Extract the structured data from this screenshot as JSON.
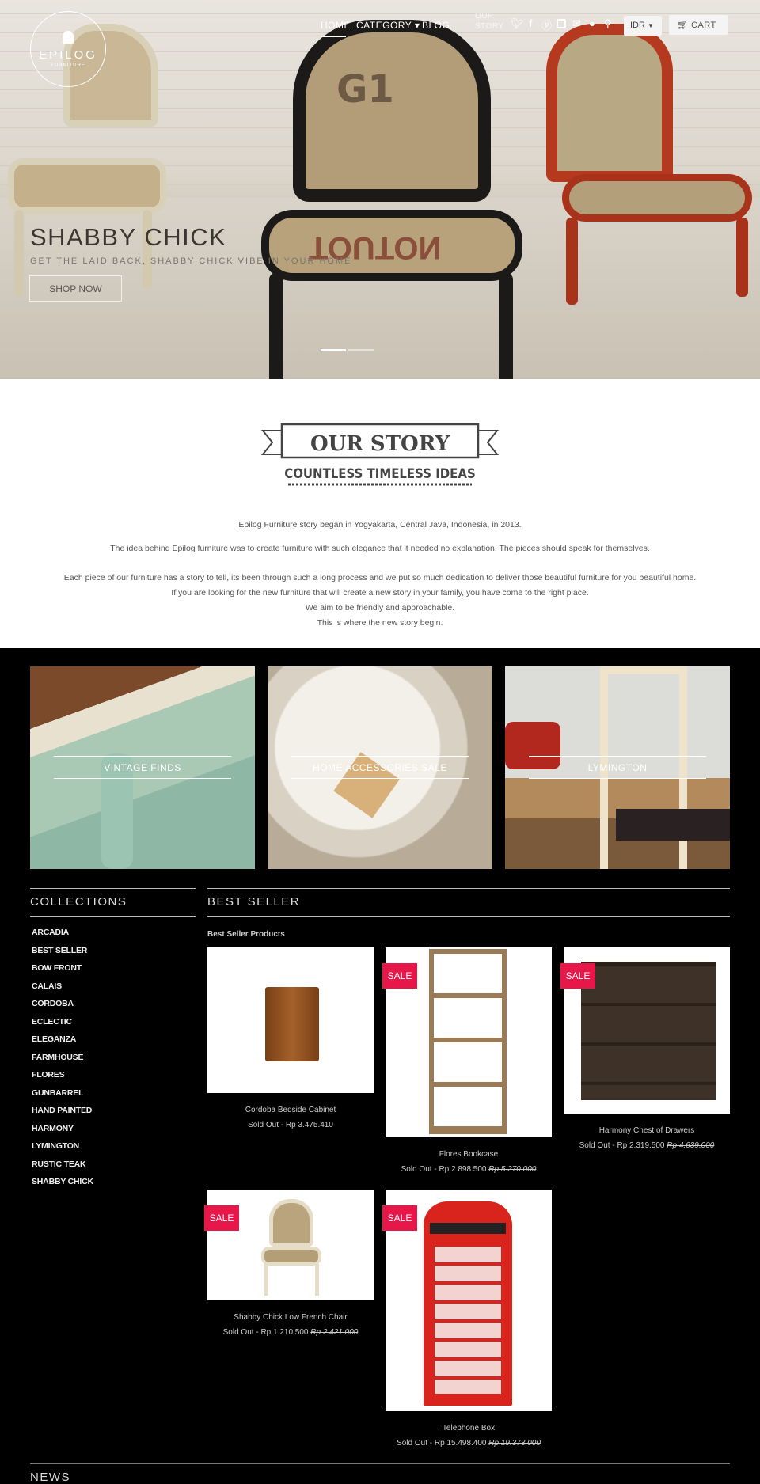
{
  "header": {
    "logo": {
      "name": "EPILOG",
      "sub": "FURNITURE"
    },
    "nav": [
      {
        "label": "HOME"
      },
      {
        "label": "CATEGORY ▾"
      },
      {
        "label": "BLOG"
      },
      {
        "label": "OUR STORY"
      }
    ],
    "icons": [
      "twitter-icon",
      "facebook-icon",
      "pinterest-icon",
      "instagram-icon",
      "mail-icon",
      "user-icon",
      "search-icon"
    ],
    "currency": "IDR",
    "cart_label": "CART"
  },
  "hero": {
    "title": "SHABBY CHICK",
    "subtitle": "GET THE LAID BACK, SHABBY CHICK VIBE IN YOUR HOME",
    "button": "SHOP NOW"
  },
  "story": {
    "banner_title": "OUR STORY",
    "banner_sub": "COUNTLESS TIMELESS IDEAS",
    "lines": [
      "Epilog Furniture story began in Yogyakarta, Central Java, Indonesia, in 2013.",
      "The idea behind Epilog furniture was to create furniture with such elegance that it needed no explanation. The pieces should speak for themselves.",
      "Each piece of our furniture has a story to tell, its been through such a long process and we put so much dedication to deliver those beautiful furniture for you beautiful home.",
      "If you are looking for the new furniture that will create a new story in your family, you have come to the right place.",
      "We aim to be friendly and approachable.",
      "This is where the new story begin."
    ]
  },
  "categories": [
    {
      "label": "VINTAGE FINDS"
    },
    {
      "label": "HOME ACCESSORIES SALE"
    },
    {
      "label": "LYMINGTON"
    }
  ],
  "collections": {
    "title": "COLLECTIONS",
    "items": [
      "ARCADIA",
      "BEST SELLER",
      "BOW FRONT",
      "CALAIS",
      "CORDOBA",
      "ECLECTIC",
      "ELEGANZA",
      "FARMHOUSE",
      "FLORES",
      "GUNBARREL",
      "HAND PAINTED",
      "HARMONY",
      "LYMINGTON",
      "RUSTIC TEAK",
      "SHABBY CHICK"
    ]
  },
  "bestseller": {
    "title": "BEST SELLER",
    "subtitle": "Best Seller Products",
    "sale_label": "SALE",
    "products": [
      {
        "name": "Cordoba Bedside Cabinet",
        "price": "Sold Out - Rp 3.475.410",
        "old_price": ""
      },
      {
        "name": "Flores Bookcase",
        "price": "Sold Out - Rp 2.898.500",
        "old_price": "Rp 5.270.000"
      },
      {
        "name": "Harmony Chest of Drawers",
        "price": "Sold Out - Rp 2.319.500",
        "old_price": "Rp 4.639.000"
      },
      {
        "name": "Shabby Chick Low French Chair",
        "price": "Sold Out - Rp 1.210.500",
        "old_price": "Rp 2.421.000"
      },
      {
        "name": "Telephone Box",
        "price": "Sold Out - Rp 15.498.400",
        "old_price": "Rp 19.373.000"
      }
    ]
  },
  "news": {
    "title": "NEWS"
  }
}
